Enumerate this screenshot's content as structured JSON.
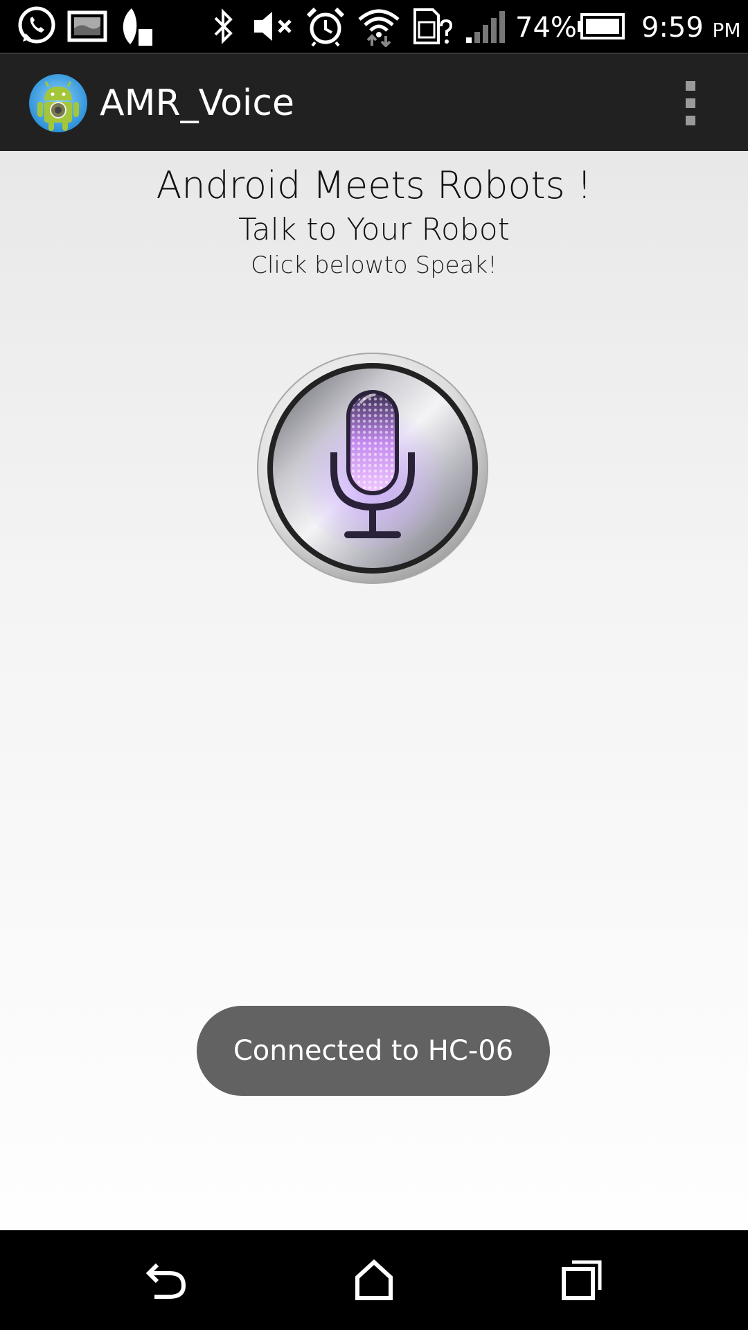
{
  "status_bar": {
    "icons": [
      "whatsapp-icon",
      "gallery-icon",
      "leaf-icon",
      "bluetooth-icon",
      "mute-icon",
      "alarm-icon",
      "wifi-icon",
      "sim-icon",
      "signal-icon",
      "battery-icon"
    ],
    "battery_percent": "74%",
    "battery_level": 0.74,
    "time": "9:59",
    "meridiem": "PM"
  },
  "action_bar": {
    "app_title": "AMR_Voice",
    "app_icon": "android-app-icon",
    "overflow_icon": "overflow-menu-icon"
  },
  "main": {
    "title": "Android Meets Robots !",
    "subtitle": "Talk to Your Robot",
    "hint": "Click belowto Speak!",
    "mic_icon": "microphone-icon"
  },
  "toast": {
    "message": "Connected to HC-06"
  },
  "nav_bar": {
    "buttons": [
      "back-icon",
      "home-icon",
      "recents-icon"
    ]
  },
  "colors": {
    "status_bar_bg": "#000000",
    "action_bar_bg": "#212121",
    "toast_bg": "#626262",
    "nav_bar_bg": "#000000"
  }
}
